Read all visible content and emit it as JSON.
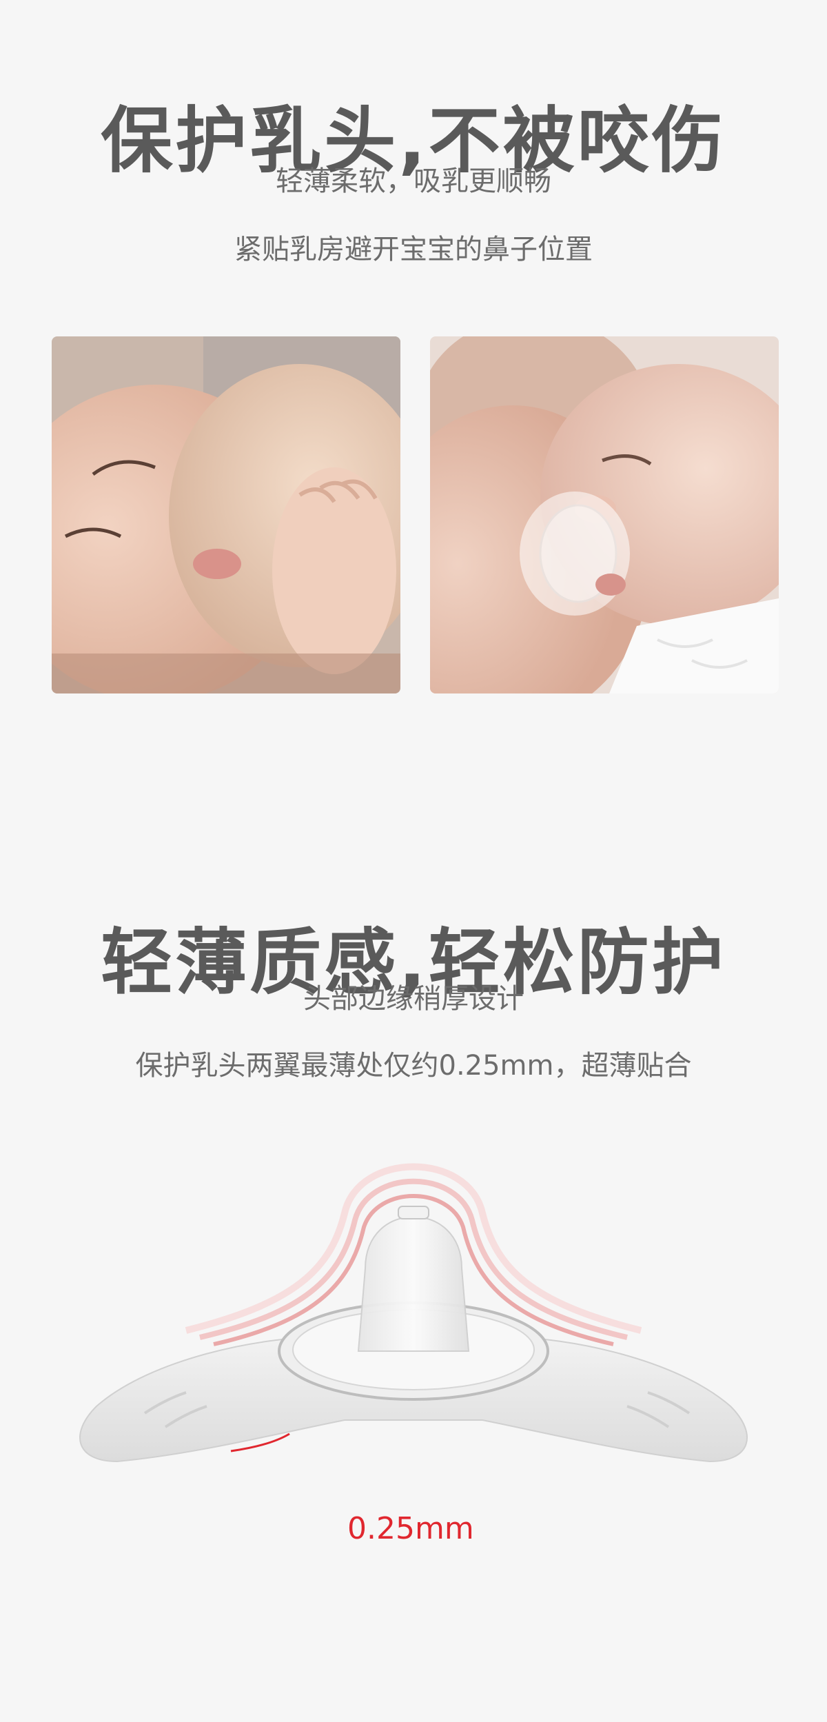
{
  "section1": {
    "headline": "保护乳头,不被咬伤",
    "line1": "轻薄柔软，吸乳更顺畅",
    "line2": "紧贴乳房避开宝宝的鼻子位置"
  },
  "photos": [
    {
      "name": "baby-breastfeeding-photo"
    },
    {
      "name": "baby-with-nipple-shield-photo"
    }
  ],
  "section2": {
    "headline": "轻薄质感,轻松防护",
    "line1": "头部边缘稍厚设计",
    "line2": "保护乳头两翼最薄处仅约0.25mm，超薄贴合"
  },
  "product": {
    "thickness_label": "0.25mm",
    "accent_color": "#e0272f"
  }
}
